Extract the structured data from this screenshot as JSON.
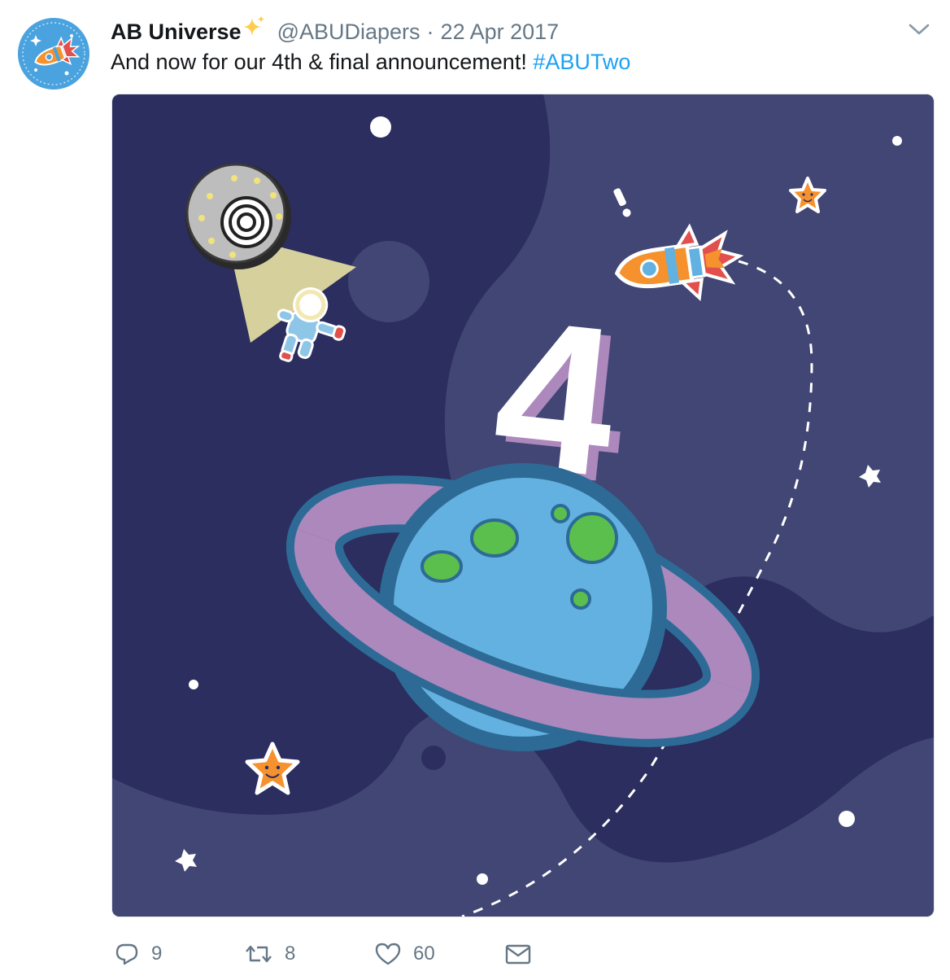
{
  "tweet": {
    "display_name": "AB Universe",
    "handle": "@ABUDiapers",
    "separator": "·",
    "date": "22 Apr 2017",
    "text": "And now for our 4th & final announcement! ",
    "hashtag": "#ABUTwo",
    "media": {
      "headline_number": "4",
      "colors": {
        "space_dark": "#2b2e5e",
        "space_light": "#424674",
        "planet": "#63b1e0",
        "ring": "#ac88bd",
        "crater": "#5bbf4d",
        "star": "#f5922e"
      }
    }
  },
  "actions": {
    "reply_count": "9",
    "retweet_count": "8",
    "like_count": "60"
  },
  "icons": {
    "caret": "chevron-down-icon",
    "reply": "reply-icon",
    "retweet": "retweet-icon",
    "like": "heart-icon",
    "dm": "envelope-icon",
    "sparkle": "sparkles-icon"
  },
  "colors": {
    "link": "#1da1f2",
    "meta": "#657786",
    "avatar_bg": "#4aa3df"
  }
}
